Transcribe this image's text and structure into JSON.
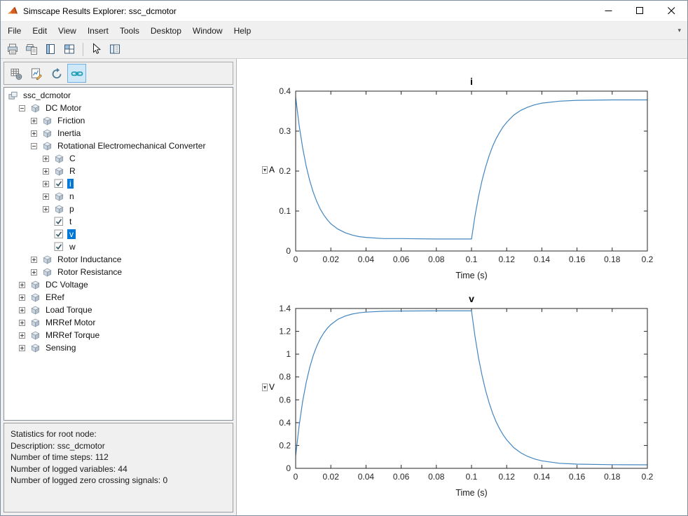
{
  "window": {
    "title": "Simscape Results Explorer: ssc_dcmotor"
  },
  "colors": {
    "selection_highlight": "#0078d7",
    "plot_line": "#4286c0",
    "toolbar_toggle_bg": "#cfe8f8"
  },
  "menu": {
    "items": [
      "File",
      "Edit",
      "View",
      "Insert",
      "Tools",
      "Desktop",
      "Window",
      "Help"
    ]
  },
  "main_toolbar": {
    "buttons": [
      {
        "icon": "print-icon"
      },
      {
        "icon": "print-preview-icon"
      },
      {
        "icon": "split-vertical-icon"
      },
      {
        "icon": "tile-windows-icon"
      },
      {
        "separator": true
      },
      {
        "icon": "pointer-icon"
      },
      {
        "icon": "show-panel-icon"
      }
    ]
  },
  "panel_toolbar": {
    "buttons": [
      {
        "icon": "statistics-options-icon"
      },
      {
        "icon": "plot-options-icon"
      },
      {
        "icon": "refresh-icon"
      },
      {
        "icon": "link-plots-icon",
        "active": true
      }
    ]
  },
  "tree": {
    "nodes": [
      {
        "label": "ssc_dcmotor",
        "level": 0,
        "icon": "model",
        "expand": null,
        "selected": false
      },
      {
        "label": "DC Motor",
        "level": 1,
        "icon": "block",
        "expand": "open",
        "selected": false
      },
      {
        "label": "Friction",
        "level": 2,
        "icon": "block",
        "expand": "closed",
        "selected": false
      },
      {
        "label": "Inertia",
        "level": 2,
        "icon": "block",
        "expand": "closed",
        "selected": false
      },
      {
        "label": "Rotational Electromechanical Converter",
        "level": 2,
        "icon": "block",
        "expand": "open",
        "selected": false
      },
      {
        "label": "C",
        "level": 3,
        "icon": "block",
        "expand": "closed",
        "selected": false
      },
      {
        "label": "R",
        "level": 3,
        "icon": "block",
        "expand": "closed",
        "selected": false
      },
      {
        "label": "i",
        "level": 3,
        "icon": "variable",
        "expand": "closed",
        "selected": true
      },
      {
        "label": "n",
        "level": 3,
        "icon": "block",
        "expand": "closed",
        "selected": false
      },
      {
        "label": "p",
        "level": 3,
        "icon": "block",
        "expand": "closed",
        "selected": false
      },
      {
        "label": "t",
        "level": 3,
        "icon": "variable",
        "expand": null,
        "selected": false
      },
      {
        "label": "v",
        "level": 3,
        "icon": "variable",
        "expand": null,
        "selected": true
      },
      {
        "label": "w",
        "level": 3,
        "icon": "variable",
        "expand": null,
        "selected": false
      },
      {
        "label": "Rotor Inductance",
        "level": 2,
        "icon": "block",
        "expand": "closed",
        "selected": false
      },
      {
        "label": "Rotor Resistance",
        "level": 2,
        "icon": "block",
        "expand": "closed",
        "selected": false
      },
      {
        "label": "DC Voltage",
        "level": 1,
        "icon": "block",
        "expand": "closed",
        "selected": false
      },
      {
        "label": "ERef",
        "level": 1,
        "icon": "block",
        "expand": "closed",
        "selected": false
      },
      {
        "label": "Load Torque",
        "level": 1,
        "icon": "block",
        "expand": "closed",
        "selected": false
      },
      {
        "label": "MRRef Motor",
        "level": 1,
        "icon": "block",
        "expand": "closed",
        "selected": false
      },
      {
        "label": "MRRef Torque",
        "level": 1,
        "icon": "block",
        "expand": "closed",
        "selected": false
      },
      {
        "label": "Sensing",
        "level": 1,
        "icon": "block",
        "expand": "closed",
        "selected": false
      }
    ]
  },
  "stats": {
    "lines": [
      "Statistics for root node:",
      "Description: ssc_dcmotor",
      "Number of time steps: 112",
      "Number of logged variables: 44",
      "Number of logged zero crossing signals: 0"
    ]
  },
  "chart_data": [
    {
      "type": "line",
      "title": "i",
      "xlabel": "Time (s)",
      "ylabel": "A",
      "legend": null,
      "grid": false,
      "xlim": [
        0,
        0.2
      ],
      "ylim": [
        0,
        0.4
      ],
      "xticks": [
        0,
        0.02,
        0.04,
        0.06,
        0.08,
        0.1,
        0.12,
        0.14,
        0.16,
        0.18,
        0.2
      ],
      "xtick_labels": [
        "0",
        "0.02",
        "0.04",
        "0.06",
        "0.08",
        "0.1",
        "0.12",
        "0.14",
        "0.16",
        "0.18",
        "0.2"
      ],
      "yticks": [
        0,
        0.1,
        0.2,
        0.3,
        0.4
      ],
      "ytick_labels": [
        "0",
        "0.1",
        "0.2",
        "0.3",
        "0.4"
      ],
      "line_color": "#4286c0",
      "x": [
        0,
        0.002,
        0.004,
        0.006,
        0.008,
        0.01,
        0.012,
        0.014,
        0.016,
        0.018,
        0.02,
        0.024,
        0.028,
        0.032,
        0.036,
        0.04,
        0.05,
        0.06,
        0.08,
        0.1,
        0.102,
        0.104,
        0.106,
        0.108,
        0.11,
        0.112,
        0.114,
        0.116,
        0.118,
        0.12,
        0.124,
        0.128,
        0.132,
        0.136,
        0.14,
        0.15,
        0.16,
        0.18,
        0.2
      ],
      "y": [
        0.385,
        0.314,
        0.258,
        0.212,
        0.176,
        0.147,
        0.124,
        0.105,
        0.09,
        0.078,
        0.068,
        0.055,
        0.046,
        0.04,
        0.036,
        0.034,
        0.031,
        0.031,
        0.03,
        0.03,
        0.088,
        0.136,
        0.177,
        0.21,
        0.238,
        0.262,
        0.281,
        0.297,
        0.311,
        0.322,
        0.34,
        0.352,
        0.36,
        0.366,
        0.37,
        0.375,
        0.377,
        0.378,
        0.378
      ]
    },
    {
      "type": "line",
      "title": "v",
      "xlabel": "Time (s)",
      "ylabel": "V",
      "legend": null,
      "grid": false,
      "xlim": [
        0,
        0.2
      ],
      "ylim": [
        0,
        1.4
      ],
      "xticks": [
        0,
        0.02,
        0.04,
        0.06,
        0.08,
        0.1,
        0.12,
        0.14,
        0.16,
        0.18,
        0.2
      ],
      "xtick_labels": [
        "0",
        "0.02",
        "0.04",
        "0.06",
        "0.08",
        "0.1",
        "0.12",
        "0.14",
        "0.16",
        "0.18",
        "0.2"
      ],
      "yticks": [
        0,
        0.2,
        0.4,
        0.6,
        0.8,
        1.0,
        1.2,
        1.4
      ],
      "ytick_labels": [
        "0",
        "0.2",
        "0.4",
        "0.6",
        "0.8",
        "1",
        "1.2",
        "1.4"
      ],
      "line_color": "#4286c0",
      "x": [
        0,
        0.002,
        0.004,
        0.006,
        0.008,
        0.01,
        0.012,
        0.014,
        0.016,
        0.018,
        0.02,
        0.024,
        0.028,
        0.032,
        0.036,
        0.04,
        0.05,
        0.06,
        0.08,
        0.1,
        0.102,
        0.104,
        0.106,
        0.108,
        0.11,
        0.112,
        0.114,
        0.116,
        0.118,
        0.12,
        0.124,
        0.128,
        0.132,
        0.136,
        0.14,
        0.15,
        0.16,
        0.18,
        0.2
      ],
      "y": [
        0.11,
        0.376,
        0.587,
        0.753,
        0.884,
        0.988,
        1.07,
        1.135,
        1.187,
        1.227,
        1.259,
        1.305,
        1.333,
        1.351,
        1.362,
        1.368,
        1.376,
        1.378,
        1.379,
        1.38,
        1.155,
        0.968,
        0.812,
        0.682,
        0.574,
        0.483,
        0.408,
        0.345,
        0.293,
        0.249,
        0.182,
        0.136,
        0.104,
        0.081,
        0.066,
        0.044,
        0.037,
        0.032,
        0.031
      ]
    }
  ]
}
